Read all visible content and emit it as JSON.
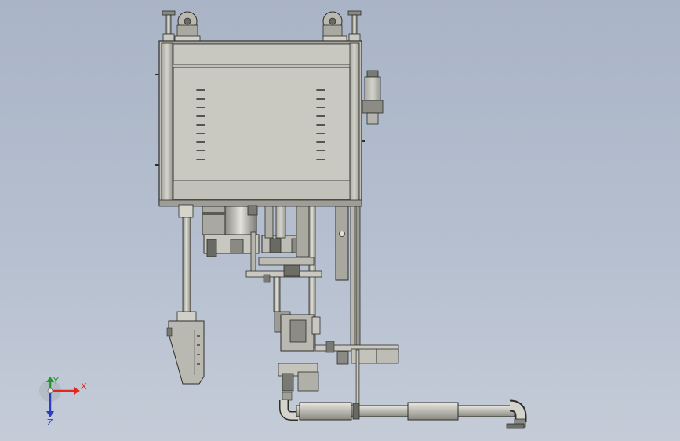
{
  "viewport": {
    "background_top": "#a9b4c6",
    "background_bottom": "#c5ccd8",
    "part_fill": "#c4c4bc",
    "part_dark": "#5a5a55",
    "outline": "#2e2e2a"
  },
  "triad": {
    "x_label": "X",
    "y_label": "Y",
    "z_label": "Z",
    "x_color": "#e0281e",
    "y_color": "#1e9a2a",
    "z_color": "#2a3cc8"
  }
}
